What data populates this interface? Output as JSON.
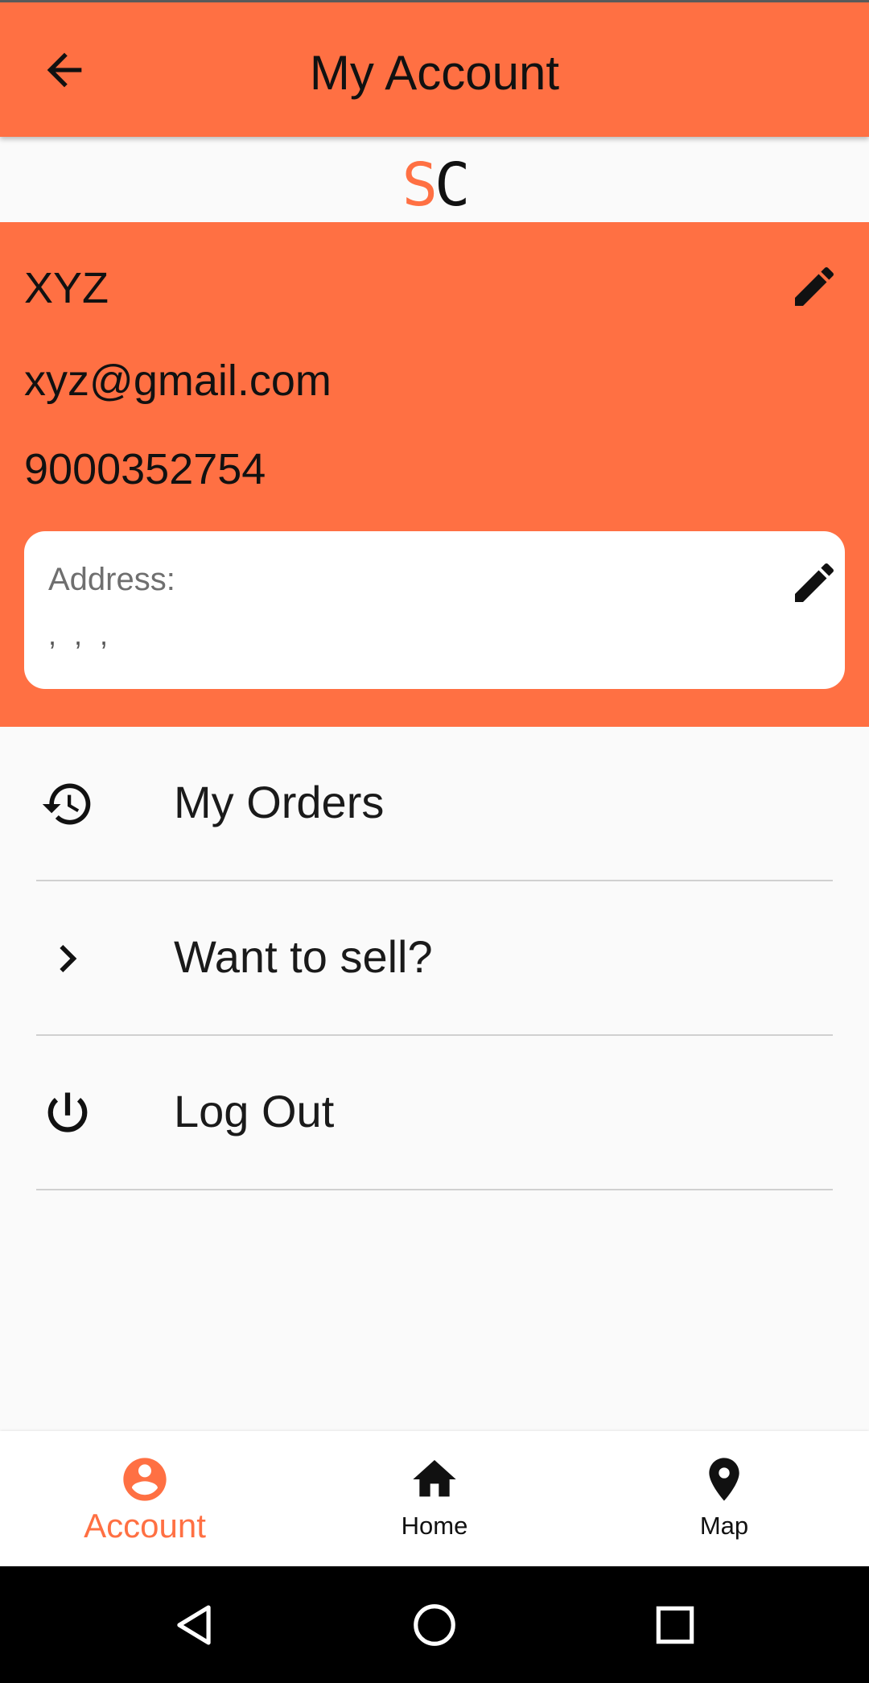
{
  "colors": {
    "accent": "#ff7043",
    "background": "#fafafa"
  },
  "appbar": {
    "title": "My Account",
    "back_icon": "arrow-back-icon"
  },
  "logo": {
    "s": "S",
    "c": "C"
  },
  "profile": {
    "name": "XYZ",
    "email": "xyz@gmail.com",
    "phone": "9000352754",
    "edit_icon": "pencil-icon",
    "address": {
      "label": "Address:",
      "value": ", , ,"
    }
  },
  "menu": {
    "items": [
      {
        "label": "My Orders",
        "icon": "history-icon"
      },
      {
        "label": "Want to sell?",
        "icon": "chevron-right-icon"
      },
      {
        "label": "Log Out",
        "icon": "power-icon"
      }
    ]
  },
  "bottom_nav": {
    "items": [
      {
        "label": "Account",
        "icon": "account-circle-icon",
        "active": true
      },
      {
        "label": "Home",
        "icon": "home-icon",
        "active": false
      },
      {
        "label": "Map",
        "icon": "map-pin-icon",
        "active": false
      }
    ]
  },
  "system_nav": {
    "icons": [
      "back-triangle-icon",
      "home-circle-icon",
      "recents-square-icon"
    ]
  }
}
